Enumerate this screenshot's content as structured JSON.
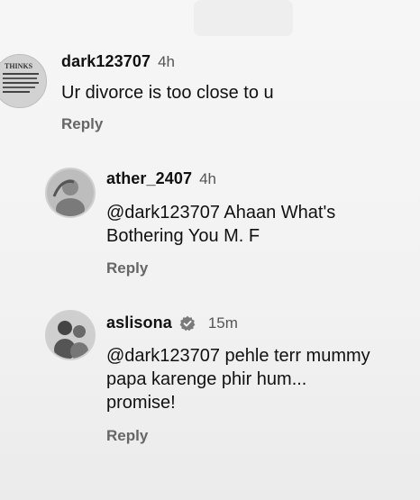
{
  "comments": [
    {
      "username": "dark123707",
      "time": "4h",
      "text": "Ur divorce is too close to u",
      "reply_label": "Reply",
      "avatar_text": "THINKS"
    },
    {
      "username": "ather_2407",
      "time": "4h",
      "text_line1": "@dark123707 Ahaan What's",
      "text_line2": "Bothering You M. F",
      "reply_label": "Reply"
    },
    {
      "username": "aslisona",
      "time": "15m",
      "text_line1": "@dark123707 pehle terr mummy",
      "text_line2": "papa karenge phir hum...",
      "text_line3": "promise!",
      "reply_label": "Reply",
      "verified": true
    }
  ]
}
